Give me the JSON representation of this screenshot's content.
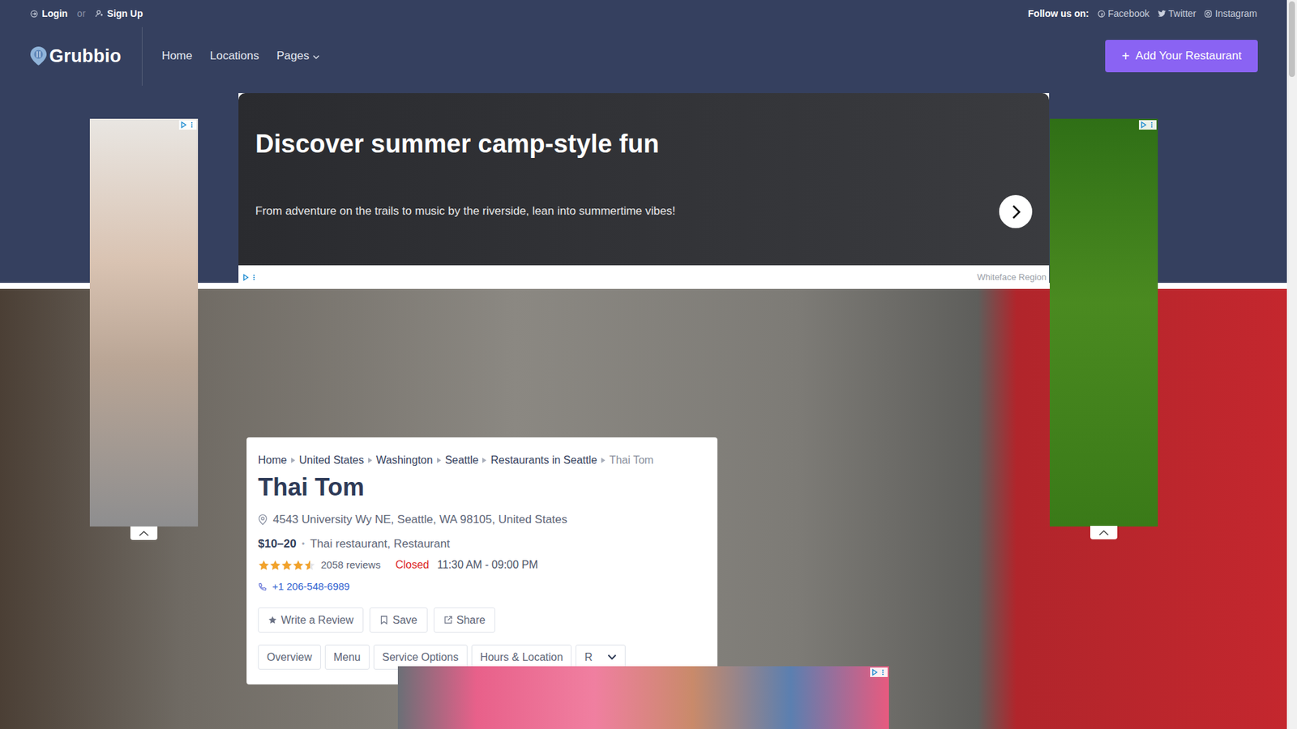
{
  "topbar": {
    "login": "Login",
    "separator": "or",
    "signup": "Sign Up",
    "follow_label": "Follow us on:",
    "social": [
      "Facebook",
      "Twitter",
      "Instagram"
    ]
  },
  "nav": {
    "logo": "Grubbio",
    "links": [
      {
        "label": "Home",
        "has_dropdown": false
      },
      {
        "label": "Locations",
        "has_dropdown": false
      },
      {
        "label": "Pages",
        "has_dropdown": true
      }
    ],
    "cta": {
      "icon": "+",
      "label": "Add Your Restaurant"
    }
  },
  "ads": {
    "top": {
      "headline": "Discover summer camp-style fun",
      "body": "From adventure on the trails to music by the riverside, lean into summertime vibes!",
      "advertiser": "Whiteface Region"
    }
  },
  "restaurant": {
    "breadcrumb": [
      {
        "label": "Home",
        "current": false
      },
      {
        "label": "United States",
        "current": false
      },
      {
        "label": "Washington",
        "current": false
      },
      {
        "label": "Seattle",
        "current": false
      },
      {
        "label": "Restaurants in Seattle",
        "current": false
      },
      {
        "label": "Thai Tom",
        "current": true
      }
    ],
    "name": "Thai Tom",
    "address": "4543 University Wy NE, Seattle, WA 98105, United States",
    "price": "$10–20",
    "separator": "•",
    "categories": "Thai restaurant, Restaurant",
    "stars": 4.5,
    "reviews": "2058 reviews",
    "status": {
      "label": "Closed",
      "open": false
    },
    "hours": "11:30 AM - 09:00 PM",
    "phone": "+1 206-548-6989",
    "actions": [
      "Write a Review",
      "Save",
      "Share"
    ],
    "tabs": [
      {
        "label": "Overview",
        "selected": false
      },
      {
        "label": "Menu",
        "selected": false
      },
      {
        "label": "Service Options",
        "selected": false
      },
      {
        "label": "Hours & Location",
        "selected": false
      },
      {
        "label": "R",
        "selected": false
      }
    ]
  }
}
